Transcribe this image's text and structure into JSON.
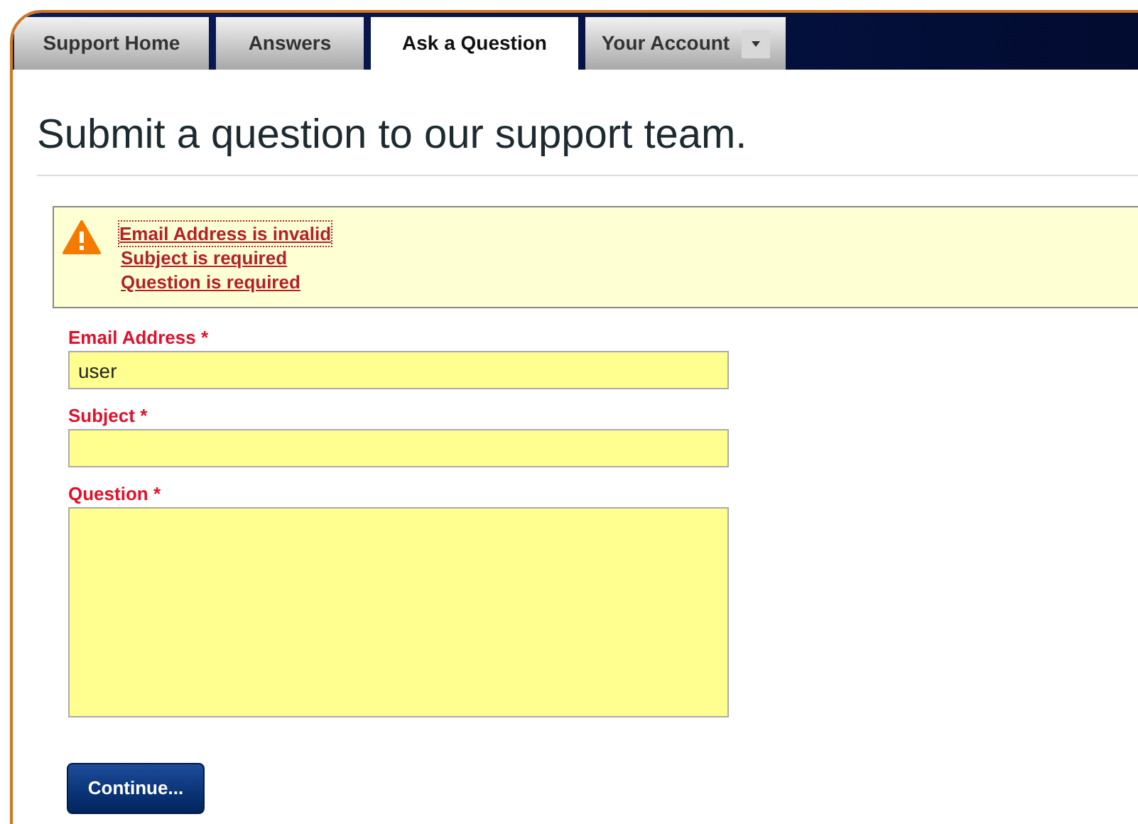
{
  "tabs": [
    {
      "label": "Support Home",
      "selected": false,
      "has_menu": false
    },
    {
      "label": "Answers",
      "selected": false,
      "has_menu": false
    },
    {
      "label": "Ask a Question",
      "selected": true,
      "has_menu": false
    },
    {
      "label": "Your Account",
      "selected": false,
      "has_menu": true
    }
  ],
  "heading": "Submit a question to our support team.",
  "errors": [
    {
      "text": "Email Address is invalid",
      "focused": true
    },
    {
      "text": "Subject is required",
      "focused": false
    },
    {
      "text": "Question is required",
      "focused": false
    }
  ],
  "fields": [
    {
      "kind": "text",
      "label": "Email Address",
      "required_mark": "*",
      "value": "user",
      "invalid": true
    },
    {
      "kind": "text",
      "label": "Subject",
      "required_mark": "*",
      "invalid": true
    },
    {
      "kind": "textarea",
      "label": "Question",
      "required_mark": "*",
      "invalid": true
    }
  ],
  "submit_button": "Continue..."
}
